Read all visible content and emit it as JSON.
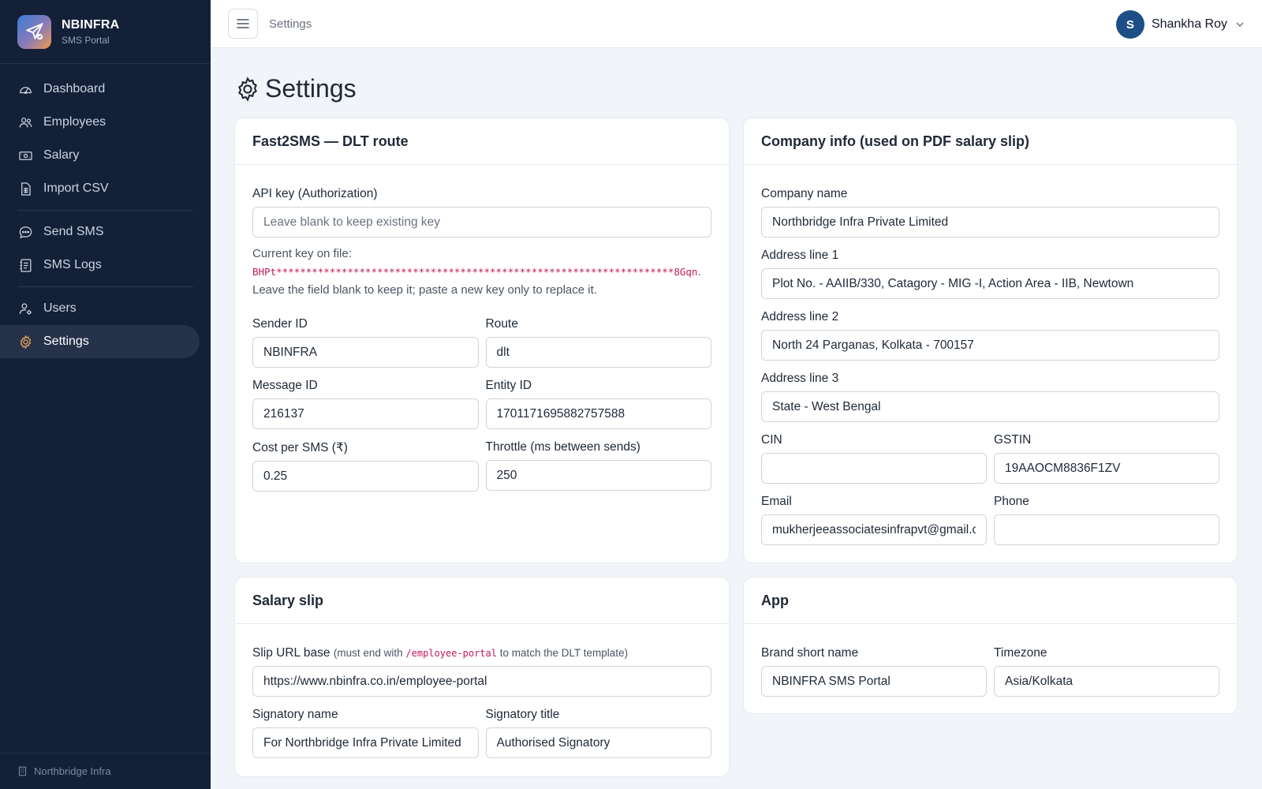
{
  "brand": {
    "title": "NBINFRA",
    "subtitle": "SMS Portal"
  },
  "nav": {
    "items": [
      {
        "label": "Dashboard",
        "icon": "gauge-icon"
      },
      {
        "label": "Employees",
        "icon": "people-icon"
      },
      {
        "label": "Salary",
        "icon": "cash-icon"
      },
      {
        "label": "Import CSV",
        "icon": "file-spreadsheet-icon"
      },
      {
        "label": "Send SMS",
        "icon": "chat-dots-icon"
      },
      {
        "label": "SMS Logs",
        "icon": "journal-text-icon"
      },
      {
        "label": "Users",
        "icon": "person-gear-icon"
      },
      {
        "label": "Settings",
        "icon": "gear-icon",
        "active": true
      }
    ],
    "footer": "Northbridge Infra"
  },
  "topbar": {
    "breadcrumb": "Settings",
    "user_initial": "S",
    "user_name": "Shankha Roy"
  },
  "page": {
    "title": "Settings"
  },
  "fast2sms": {
    "title": "Fast2SMS — DLT route",
    "api_key_label": "API key (Authorization)",
    "api_key_placeholder": "Leave blank to keep existing key",
    "current_key_prefix": "Current key on file:",
    "current_key_masked": "BHPt*******************************************************************8Gqn",
    "current_key_suffix": ". Leave the field blank to keep it; paste a new key only to replace it.",
    "sender_id_label": "Sender ID",
    "sender_id": "NBINFRA",
    "route_label": "Route",
    "route": "dlt",
    "message_id_label": "Message ID",
    "message_id": "216137",
    "entity_id_label": "Entity ID",
    "entity_id": "1701171695882757588",
    "cost_label": "Cost per SMS (₹)",
    "cost": "0.25",
    "throttle_label": "Throttle (ms between sends)",
    "throttle": "250"
  },
  "company": {
    "title": "Company info (used on PDF salary slip)",
    "name_label": "Company name",
    "name": "Northbridge Infra Private Limited",
    "addr1_label": "Address line 1",
    "addr1": "Plot No. - AAIIB/330, Catagory - MIG -I, Action Area - IIB, Newtown",
    "addr2_label": "Address line 2",
    "addr2": "North 24 Parganas, Kolkata - 700157",
    "addr3_label": "Address line 3",
    "addr3": "State - West Bengal",
    "cin_label": "CIN",
    "cin": "",
    "gstin_label": "GSTIN",
    "gstin": "19AAOCM8836F1ZV",
    "email_label": "Email",
    "email": "mukherjeeassociatesinfrapvt@gmail.com",
    "phone_label": "Phone",
    "phone": ""
  },
  "salary_slip": {
    "title": "Salary slip",
    "url_label": "Slip URL base",
    "url_hint_prefix": "(must end with",
    "url_hint_code": "/employee-portal",
    "url_hint_suffix": "to match the DLT template)",
    "url": "https://www.nbinfra.co.in/employee-portal",
    "signatory_name_label": "Signatory name",
    "signatory_name": "For Northbridge Infra Private Limited",
    "signatory_title_label": "Signatory title",
    "signatory_title": "Authorised Signatory"
  },
  "app": {
    "title": "App",
    "brand_short_label": "Brand short name",
    "brand_short": "NBINFRA SMS Portal",
    "timezone_label": "Timezone",
    "timezone": "Asia/Kolkata"
  }
}
